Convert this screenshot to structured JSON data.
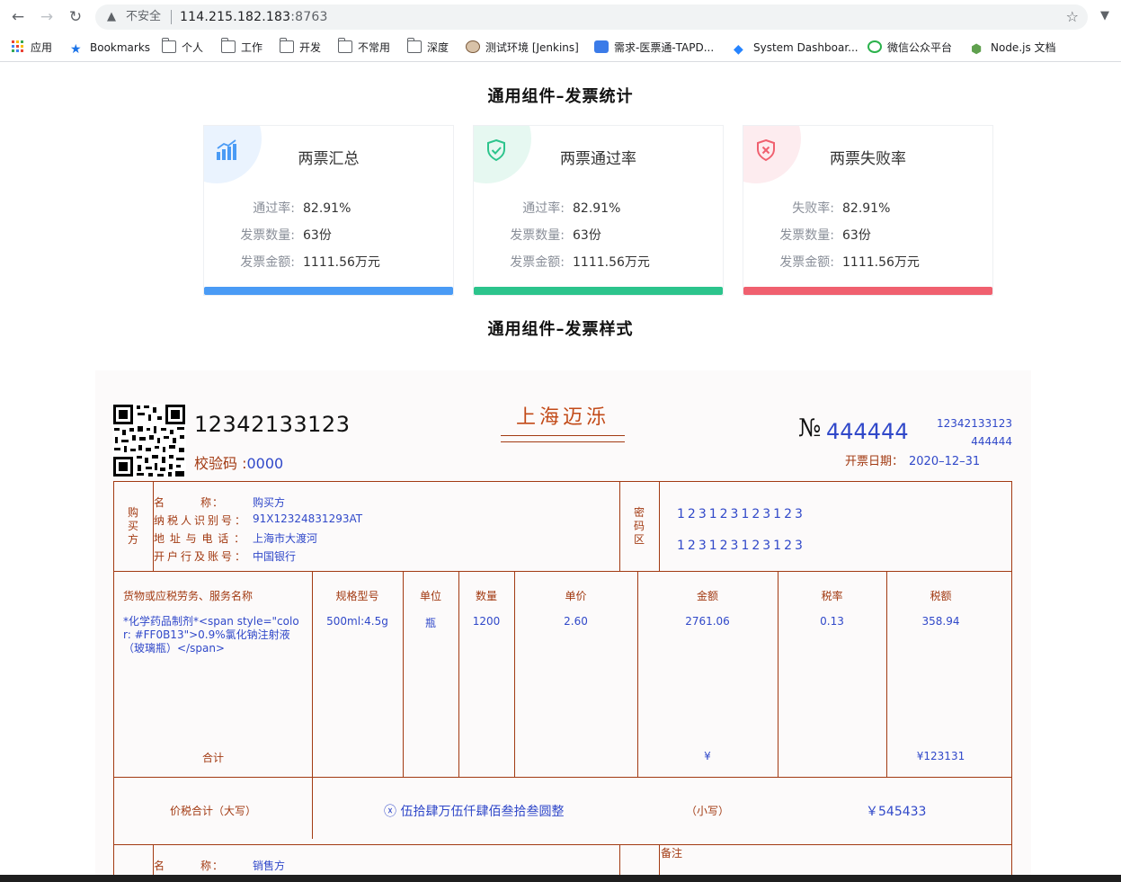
{
  "browser": {
    "insecure_label": "不安全",
    "url_host": "114.215.182.183",
    "url_port": ":8763",
    "bookmarks": [
      "应用",
      "Bookmarks",
      "个人",
      "工作",
      "开发",
      "不常用",
      "深度",
      "测试环境 [Jenkins]",
      "需求-医票通-TAPD...",
      "System Dashboar...",
      "微信公众平台",
      "Node.js 文档"
    ]
  },
  "stats": {
    "title": "通用组件–发票统计",
    "cards": [
      {
        "title": "两票汇总",
        "icon": "bar-chart-icon",
        "color": "#4a9bf5",
        "corner": "#eaf3fe",
        "rows": [
          {
            "label": "通过率:",
            "value": "82.91%"
          },
          {
            "label": "发票数量:",
            "value": "63份"
          },
          {
            "label": "发票金额:",
            "value": "1111.56万元"
          }
        ]
      },
      {
        "title": "两票通过率",
        "icon": "shield-check-icon",
        "color": "#2cc48c",
        "corner": "#e6f8f1",
        "rows": [
          {
            "label": "通过率:",
            "value": "82.91%"
          },
          {
            "label": "发票数量:",
            "value": "63份"
          },
          {
            "label": "发票金额:",
            "value": "1111.56万元"
          }
        ]
      },
      {
        "title": "两票失败率",
        "icon": "shield-x-icon",
        "color": "#f0606f",
        "corner": "#fdecef",
        "rows": [
          {
            "label": "失败率:",
            "value": "82.91%"
          },
          {
            "label": "发票数量:",
            "value": "63份"
          },
          {
            "label": "发票金额:",
            "value": "1111.56万元"
          }
        ]
      }
    ]
  },
  "invoice_section_title": "通用组件–发票样式",
  "invoice": {
    "code": "12342133123",
    "check_label": "校验码 :",
    "check_value": "0000",
    "title": "上海迈泺",
    "no_sign": "№",
    "no": "444444",
    "no_small_1": "12342133123",
    "no_small_2": "444444",
    "date_label": "开票日期：",
    "date_value": "2020–12–31",
    "buyer": {
      "side_label": "购买方",
      "name_label": "名　　　称：",
      "name_value": "购买方",
      "tax_label": "纳税人识别号：",
      "tax_value": "91X12324831293AT",
      "addr_label": "地 址 与 电 话 ：",
      "addr_value": "上海市大渡河",
      "bank_label": "开户行及账号：",
      "bank_value": "中国银行"
    },
    "password": {
      "side_label": "密码区",
      "line1": "123123123123",
      "line2": "123123123123"
    },
    "items": {
      "headers": [
        "货物或应税劳务、服务名称",
        "规格型号",
        "单位",
        "数量",
        "单价",
        "金额",
        "税率",
        "税额"
      ],
      "row": [
        "*化学药品制剂*<span style=\"color: #FF0B13\">0.9%氯化钠注射液（玻璃瓶）</span>",
        "500ml:4.5g",
        "瓶",
        "1200",
        "2.60",
        "2761.06",
        "0.13",
        "358.94"
      ],
      "total_label": "合计",
      "total_amount": "¥",
      "total_tax": "¥123131"
    },
    "sum": {
      "label": "价税合计（大写）",
      "upper": "ⓧ 伍拾肆万伍仟肆佰叁拾叁圆整",
      "small_label": "（小写）",
      "small_value": "￥545433"
    },
    "seller": {
      "name_label": "名　　　称：",
      "name_value": "销售方",
      "remark_label": "备注"
    }
  }
}
